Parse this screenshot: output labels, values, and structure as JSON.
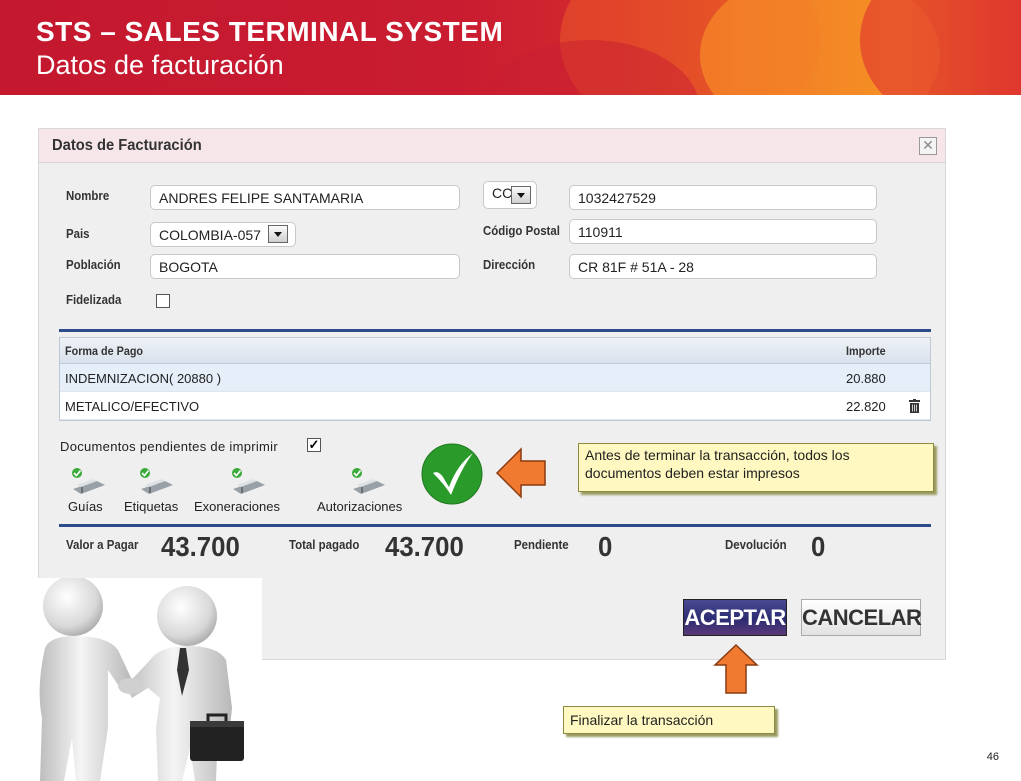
{
  "header": {
    "title": "STS – SALES  TERMINAL SYSTEM",
    "subtitle": "Datos de facturación"
  },
  "dialog": {
    "title": "Datos de Facturación",
    "close_icon": "close-icon",
    "fields": {
      "nombre_label": "Nombre",
      "nombre_value": "ANDRES FELIPE SANTAMARIA",
      "doc_type_value": "CC",
      "doc_number_value": "1032427529",
      "pais_label": "Pais",
      "pais_value": "COLOMBIA-057",
      "codigo_postal_label": "Código Postal",
      "codigo_postal_value": "110911",
      "poblacion_label": "Población",
      "poblacion_value": "BOGOTA",
      "direccion_label": "Dirección",
      "direccion_value": "CR 81F # 51A - 28",
      "fidelizada_label": "Fidelizada",
      "fidelizada_checked": false
    },
    "payments": {
      "headers": [
        "Forma de Pago",
        "Importe"
      ],
      "rows": [
        {
          "forma": "INDEMNIZACION( 20880 )",
          "importe": "20.880",
          "selected": true
        },
        {
          "forma": "METALICO/EFECTIVO",
          "importe": "22.820",
          "selected": false,
          "trash_icon": "trash-icon"
        }
      ]
    },
    "documents": {
      "label": "Documentos pendientes de imprimir",
      "checked": true,
      "items": [
        {
          "label": "Guías",
          "icon": "printer-check-icon"
        },
        {
          "label": "Etiquetas",
          "icon": "printer-check-icon"
        },
        {
          "label": "Exoneraciones",
          "icon": "printer-check-icon"
        },
        {
          "label": "Autorizaciones",
          "icon": "printer-check-icon"
        }
      ]
    },
    "totals": {
      "valor_label": "Valor a Pagar",
      "valor_value": "43.700",
      "total_pagado_label": "Total pagado",
      "total_pagado_value": "43.700",
      "pendiente_label": "Pendiente",
      "pendiente_value": "0",
      "devolucion_label": "Devolución",
      "devolucion_value": "0"
    },
    "buttons": {
      "accept_label": "ACEPTAR",
      "cancel_label": "CANCELAR"
    }
  },
  "annotations": {
    "callout_print": "Antes de terminar la transacción, todos los documentos deben estar impresos",
    "callout_finish": "Finalizar la transacción",
    "check_icon": "green-check-icon",
    "arrow_left_icon": "orange-arrow-left-icon",
    "arrow_up_icon": "orange-arrow-up-icon",
    "illustration": "handshake-figures-illustration"
  },
  "page_number": "46",
  "colors": {
    "banner_red": "#c4182f",
    "banner_orange": "#f08a22",
    "accept_button": "#2c2c72",
    "separator_blue": "#2a4a8a",
    "callout_yellow": "#fff8c0",
    "check_green": "#2a9a2a",
    "arrow_orange": "#f07a30"
  }
}
